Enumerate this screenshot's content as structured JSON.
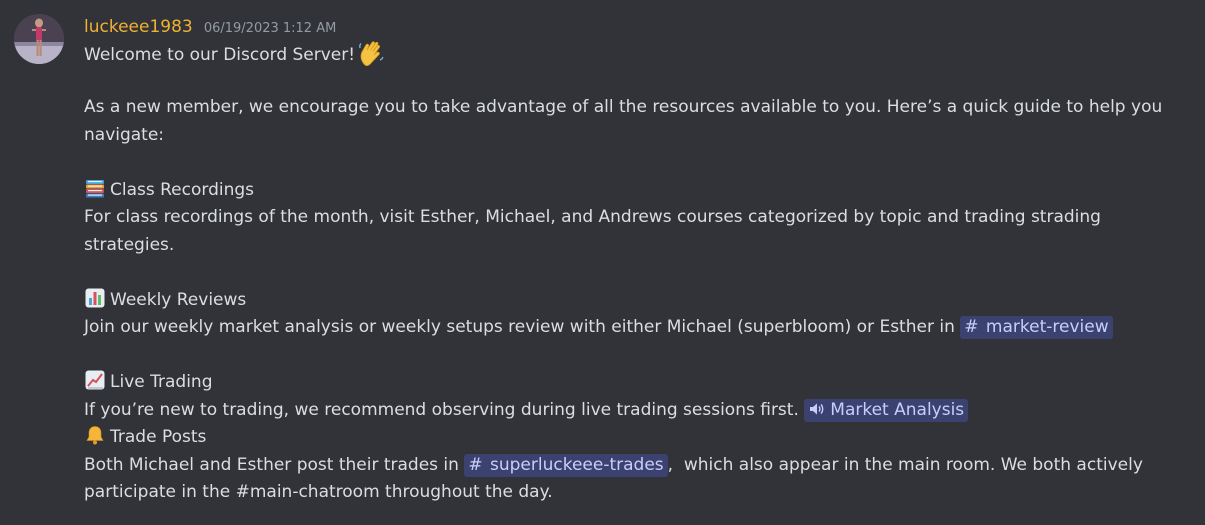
{
  "message": {
    "username": "luckeee1983",
    "timestamp": "06/19/2023 1:12 AM",
    "intro_text": "Welcome to our Discord Server!",
    "intro_emoji": "waving-hand-icon",
    "guide_line1": "As a new member, we encourage you to take advantage of all the resources available to you. Here’s a quick guide to help you",
    "guide_line2": "navigate:",
    "sections": [
      {
        "icon": "books-icon",
        "title": "Class Recordings",
        "line1": "For class recordings of the month, visit Esther, Michael, and Andrews courses categorized by topic and trading strading",
        "line2": "strategies."
      },
      {
        "icon": "bar-chart-icon",
        "title": "Weekly Reviews",
        "line1": "Join our weekly market analysis or weekly setups review with either Michael (superbloom) or Esther in",
        "channel": "market-review"
      },
      {
        "icon": "chart-increasing-icon",
        "title": "Live Trading",
        "line1": "If you’re new to trading, we recommend observing during live trading sessions first.",
        "voice_channel": "Market Analysis"
      },
      {
        "icon": "bell-icon",
        "title": "Trade Posts",
        "line1_pre": "Both Michael and Esther post their trades in",
        "channel": "superluckeee-trades",
        "line1_post": ",  which also appear in the main room. We both actively",
        "line2": "participate in the #main-chatroom throughout the day."
      }
    ]
  },
  "colors": {
    "background": "#313338",
    "username": "#f0b232",
    "timestamp": "#949ba4",
    "text": "#dbdee1",
    "mention_bg": "#3c4270",
    "mention_text": "#c9cdfb"
  }
}
